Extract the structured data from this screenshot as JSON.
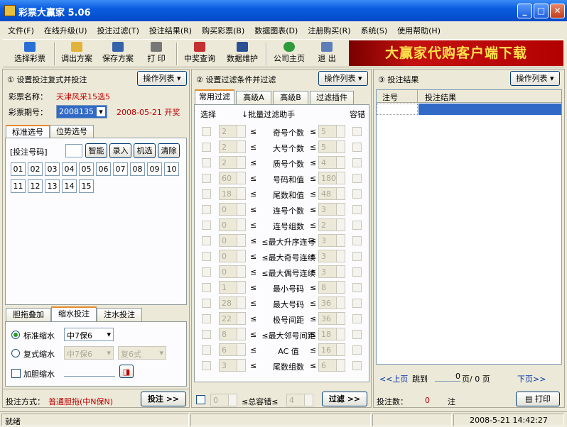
{
  "window": {
    "title": "彩票大赢家 5.06"
  },
  "menu": [
    "文件(F)",
    "在线升级(U)",
    "投注过滤(T)",
    "投注结果(R)",
    "购买彩票(B)",
    "数据图表(D)",
    "注册购买(R)",
    "系统(S)",
    "使用帮助(H)"
  ],
  "toolbar": {
    "select_lottery": "选择彩票",
    "export": "调出方案",
    "save": "保存方案",
    "print": "打 印",
    "prize_query": "中奖查询",
    "data_maint": "数据维护",
    "home": "公司主页",
    "exit": "退 出",
    "banner": "大赢家代购客户端下载"
  },
  "left": {
    "title": "① 设置投注复式并投注",
    "ops": "操作列表",
    "lottery_label": "彩票名称：",
    "lottery_name": "天津风采15选5",
    "period_label": "彩票期号：",
    "period": "2008135",
    "date": "2008-05-21 开奖",
    "tabs": [
      "标准选号",
      "位势选号"
    ],
    "bet_label": "[投注号码]",
    "buttons": [
      "智能",
      "录入",
      "机选",
      "清除"
    ],
    "numbers": [
      "01",
      "02",
      "03",
      "04",
      "05",
      "06",
      "07",
      "08",
      "09",
      "10",
      "11",
      "12",
      "13",
      "14",
      "15"
    ],
    "tabs2": [
      "胆拖叠加",
      "缩水投注",
      "注水投注"
    ],
    "std_label": "标准缩水",
    "std_value": "中7保6",
    "cpx_label": "复式缩水",
    "cpx_value": "中7保6",
    "cpx_value2": "复6式",
    "dan_label": "加胆缩水",
    "mode_label": "投注方式：",
    "mode_value": "普通胆拖(中N保N)",
    "bet_btn": "投注 >>"
  },
  "mid": {
    "title": "② 设置过滤条件并过滤",
    "ops": "操作列表",
    "tabs": [
      "常用过滤",
      "高级A",
      "高级B",
      "过滤插件"
    ],
    "col_select": "选择",
    "col_helper": "↓批量过滤助手",
    "col_tol": "容错",
    "rows": [
      {
        "min": "2",
        "label": "奇号个数",
        "max": "5"
      },
      {
        "min": "2",
        "label": "大号个数",
        "max": "5"
      },
      {
        "min": "2",
        "label": "质号个数",
        "max": "4"
      },
      {
        "min": "60",
        "label": "号码和值",
        "max": "180"
      },
      {
        "min": "18",
        "label": "尾数和值",
        "max": "48"
      },
      {
        "min": "0",
        "label": "连号个数",
        "max": "3"
      },
      {
        "min": "0",
        "label": "连号组数",
        "max": "2"
      },
      {
        "min": "0",
        "label": "≤最大升序连号",
        "max": "3"
      },
      {
        "min": "0",
        "label": "≤最大奇号连续",
        "max": "3"
      },
      {
        "min": "0",
        "label": "≤最大偶号连续",
        "max": "3"
      },
      {
        "min": "1",
        "label": "最小号码",
        "max": "8"
      },
      {
        "min": "28",
        "label": "最大号码",
        "max": "36"
      },
      {
        "min": "22",
        "label": "极号间距",
        "max": "36"
      },
      {
        "min": "8",
        "label": "≤最大邻号间距",
        "max": "18"
      },
      {
        "min": "6",
        "label": "AC 值",
        "max": "16"
      },
      {
        "min": "3",
        "label": "尾数组数",
        "max": "6"
      }
    ],
    "lt": "≤",
    "tol_min": "0",
    "tol_label": "≤总容错≤",
    "tol_max": "4",
    "filter_btn": "过滤 >>"
  },
  "right": {
    "title": "③ 投注结果",
    "ops": "操作列表",
    "col1": "注号",
    "col2": "投注结果",
    "prev": "<<上页",
    "jump": "跳到",
    "page": "0",
    "pages": "页/ 0 页",
    "next": "下页>>",
    "count_label": "投注数：",
    "count": "0",
    "unit": "注",
    "print": "打印"
  },
  "status": {
    "text": "就绪",
    "datetime": "2008-5-21 14:42:27"
  },
  "colors": {
    "accent": "#c00000",
    "title": "#0a5ddf"
  }
}
